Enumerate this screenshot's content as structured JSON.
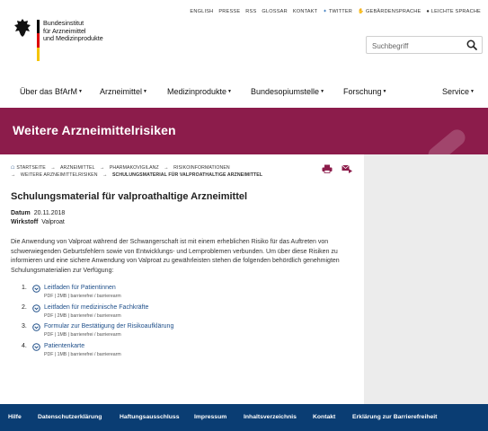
{
  "header": {
    "org_lines": [
      "Bundesinstitut",
      "für Arzneimittel",
      "und Medizinprodukte"
    ],
    "utility": [
      "ENGLISH",
      "PRESSE",
      "RSS",
      "GLOSSAR",
      "KONTAKT",
      "TWITTER",
      "GEBÄRDENSPRACHE",
      "LEICHTE SPRACHE"
    ],
    "search_placeholder": "Suchbegriff"
  },
  "nav": {
    "items": [
      "Über das BfArM",
      "Arzneimittel",
      "Medizinprodukte",
      "Bundesopiumstelle",
      "Forschung",
      "Service"
    ]
  },
  "banner": {
    "title": "Weitere Arzneimittelrisiken"
  },
  "breadcrumb": {
    "items": [
      "STARTSEITE",
      "ARZNEIMITTEL",
      "PHARMAKOVIGILANZ",
      "RISIKOINFORMATIONEN",
      "WEITERE ARZNEIMITTELRISIKEN"
    ],
    "current": "SCHULUNGSMATERIAL FÜR VALPROATHALTIGE ARZNEIMITTEL"
  },
  "document": {
    "title": "Schulungsmaterial für valproathaltige Arzneimittel",
    "date_label": "Datum",
    "date_value": "20.11.2018",
    "substance_label": "Wirkstoff",
    "substance_value": "Valproat",
    "body": "Die Anwendung von Valproat während der Schwangerschaft ist mit einem erheblichen Risiko für das Auftreten von schwerwiegenden Geburtsfehlern sowie von Entwicklungs- und Lernproblemen verbunden. Um über diese Risiken zu informieren und eine sichere Anwendung von Valproat zu gewährleisten stehen die folgenden behördlich genehmigten Schulungsmaterialien zur Verfügung:"
  },
  "downloads": [
    {
      "num": "1.",
      "label": "Leitfaden für Patientinnen",
      "info": "PDF | 2MB | barrierefrei / barrierearm"
    },
    {
      "num": "2.",
      "label": "Leitfaden für medizinische Fachkräfte",
      "info": "PDF | 2MB | barrierefrei / barrierearm"
    },
    {
      "num": "3.",
      "label": "Formular zur Bestätigung der Risikoaufklärung",
      "info": "PDF | 1MB | barrierefrei / barrierearm"
    },
    {
      "num": "4.",
      "label": "Patientenkarte",
      "info": "PDF | 1MB | barrierefrei / barrierearm"
    }
  ],
  "footer": {
    "links": [
      "Hilfe",
      "Datenschutzerklärung",
      "Haftungsausschluss",
      "Impressum",
      "Inhaltsverzeichnis",
      "Kontakt",
      "Erklärung zur Barrierefreiheit"
    ]
  },
  "colors": {
    "banner": "#8c1c4b",
    "footer": "#0a3d73",
    "link": "#1d4e89",
    "print_icon": "#8c1c4b"
  }
}
